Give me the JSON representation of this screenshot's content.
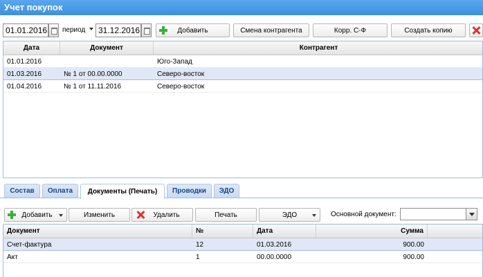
{
  "title": "Учет покупок",
  "toolbar": {
    "date_from": "01.01.2016",
    "period_label": "период",
    "date_to": "31.12.2016",
    "add_label": "Добавить",
    "change_counterparty_label": "Смена контрагента",
    "corr_label": "Корр. С-Ф",
    "create_copy_label": "Создать копию"
  },
  "main_table": {
    "headers": [
      "Дата",
      "Документ",
      "Контрагент"
    ],
    "rows": [
      {
        "date": "01.01.2016",
        "document": "",
        "counterparty": "Юго-Запад",
        "selected": false
      },
      {
        "date": "01.03.2016",
        "document": "№ 1 от 00.00.0000",
        "counterparty": "Северо-восток",
        "selected": true
      },
      {
        "date": "01.04.2016",
        "document": "№ 1 от 11.11.2016",
        "counterparty": "Северо-восток",
        "selected": false
      }
    ]
  },
  "tabs": [
    {
      "label": "Состав",
      "active": false
    },
    {
      "label": "Оплата",
      "active": false
    },
    {
      "label": "Документы (Печать)",
      "active": true
    },
    {
      "label": "Проводки",
      "active": false
    },
    {
      "label": "ЭДО",
      "active": false
    }
  ],
  "sub_toolbar": {
    "add_label": "Добавить",
    "edit_label": "Изменить",
    "delete_label": "Удалить",
    "print_label": "Печать",
    "edo_label": "ЭДО",
    "main_doc_label": "Основной документ:",
    "main_doc_value": ""
  },
  "doc_table": {
    "headers": [
      "Документ",
      "№",
      "Дата",
      "Сумма"
    ],
    "rows": [
      {
        "document": "Счет-фактура",
        "number": "12",
        "date": "01.03.2016",
        "sum": "900.00",
        "selected": true
      },
      {
        "document": "Акт",
        "number": "1",
        "date": "00.00.0000",
        "sum": "900.00",
        "selected": false
      }
    ]
  }
}
